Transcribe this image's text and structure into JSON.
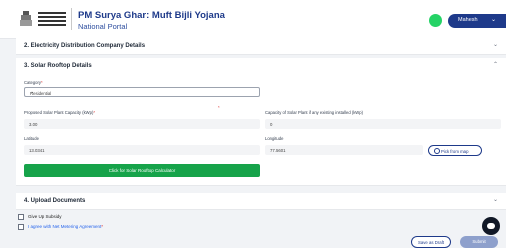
{
  "header": {
    "title": "PM Surya Ghar: Muft Bijli Yojana",
    "subtitle": "National Portal",
    "user_name": "Mahesh"
  },
  "sections": {
    "distribution": {
      "title": "2. Electricity Distribution Company Details"
    },
    "solar": {
      "title": "3. Solar Rooftop Details"
    },
    "upload": {
      "title": "4. Upload Documents"
    }
  },
  "form": {
    "category_label": "Category",
    "category_value": "Residential",
    "capacity_label": "Proposed Solar Plant Capacity (kWp)",
    "capacity_value": "3.00",
    "existing_label": "Capacity of Solar Plant if any existing installed (kWp)",
    "existing_value": "0",
    "latitude_label": "Latitude",
    "latitude_value": "13.0341",
    "longitude_label": "Longitude",
    "longitude_value": "77.5601",
    "map_button": "Pick from map",
    "calc_button": "Click for Solar Rooftop Calculator"
  },
  "checks": {
    "give_up": "Give Up Subsidy",
    "agree": "I agree with Net Metering Agreement"
  },
  "actions": {
    "draft": "Save as Draft",
    "submit": "Submit"
  },
  "colors": {
    "primary": "#1e3a8a",
    "green": "#16a34a",
    "required": "#dc2626"
  }
}
